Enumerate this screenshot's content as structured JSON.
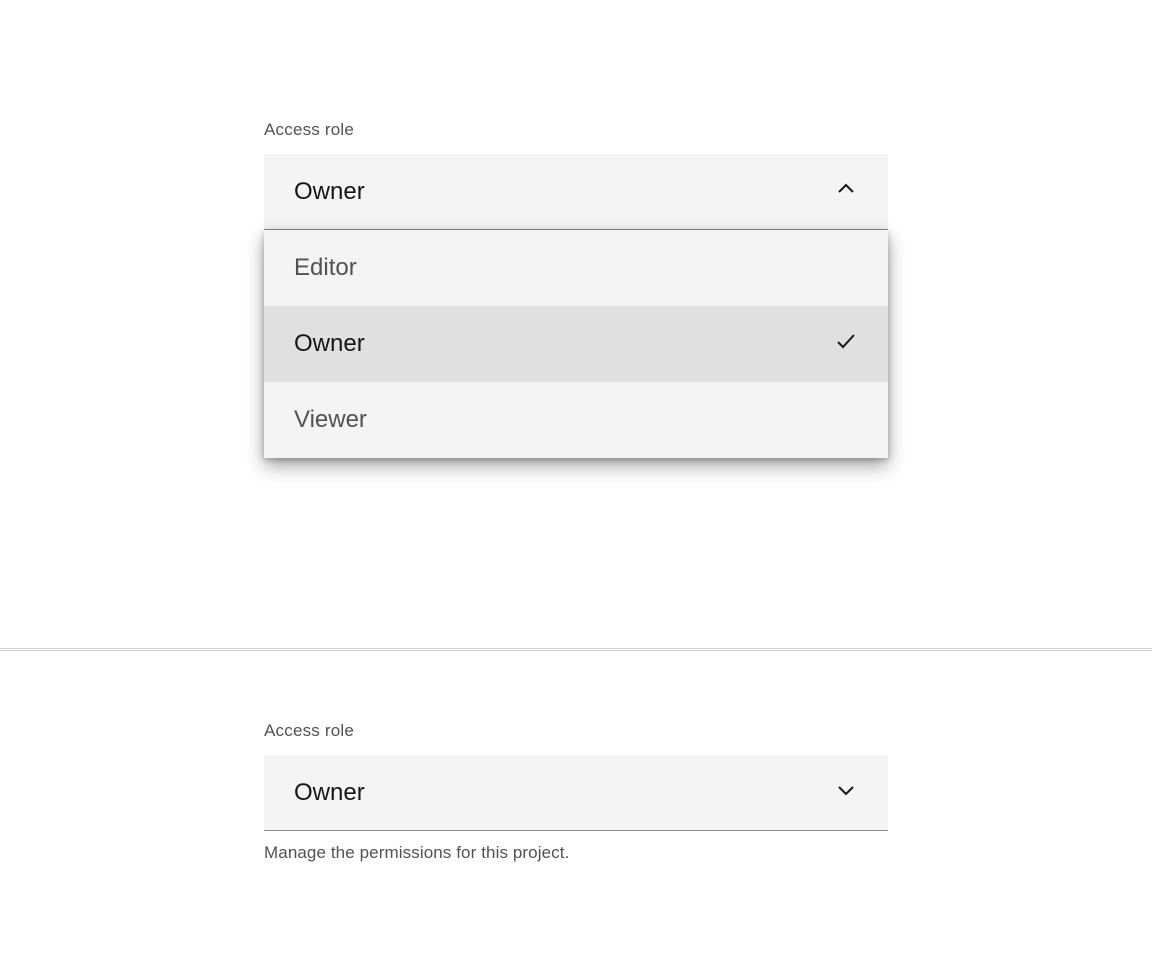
{
  "top": {
    "label": "Access role",
    "selected_value": "Owner",
    "options": [
      {
        "label": "Editor",
        "selected": false
      },
      {
        "label": "Owner",
        "selected": true
      },
      {
        "label": "Viewer",
        "selected": false
      }
    ]
  },
  "bottom": {
    "label": "Access role",
    "selected_value": "Owner",
    "helper": "Manage the permissions for this project."
  }
}
